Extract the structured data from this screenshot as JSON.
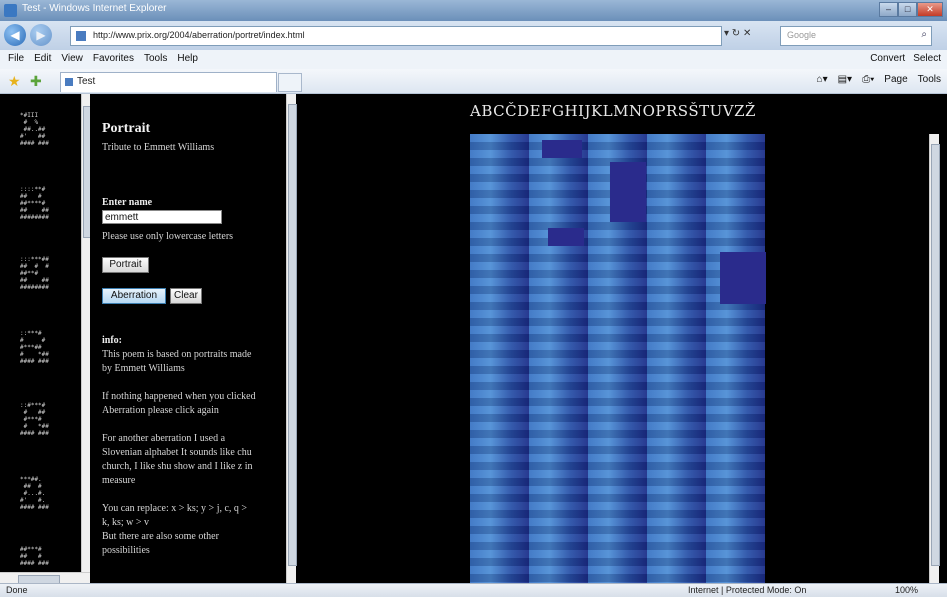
{
  "window": {
    "title": "Test - Windows Internet Explorer"
  },
  "address_bar": {
    "url": "http://www.prix.org/2004/aberration/portret/index.html",
    "search_placeholder": "Google"
  },
  "menu": [
    "File",
    "Edit",
    "View",
    "Favorites",
    "Tools",
    "Help"
  ],
  "menu_right": [
    "Convert",
    "Select"
  ],
  "tab": {
    "label": "Test"
  },
  "command_bar": [
    "Page",
    "Tools"
  ],
  "left_panel": {
    "title": "Portrait",
    "subtitle": "Tribute to Emmett Williams",
    "enter_label": "Enter name",
    "name_value": "emmett",
    "hint": "Please use only lowercase letters",
    "portrait_button": "Portrait",
    "aberration_button": "Aberration",
    "clear_button": "Clear",
    "info_label": "info:",
    "info_lines": [
      "This poem is based on portraits made",
      "by Emmett Williams",
      "If nothing happened when you clicked",
      "Aberration please click again",
      "For another aberration I used a",
      "Slovenian alphabet It sounds like chu",
      "church, I like shu show and I like z in",
      "measure",
      "You can replace: x > ks; y > j, c, q >",
      "k, ks; w > v",
      "But there are also some other",
      "possibilities"
    ]
  },
  "alphabet": "ABCČDEFGHIJKLMNOPRSŠTUVZŽ",
  "status": {
    "left": "Done",
    "zone": "Internet | Protected Mode: On",
    "zoom": "100%"
  }
}
